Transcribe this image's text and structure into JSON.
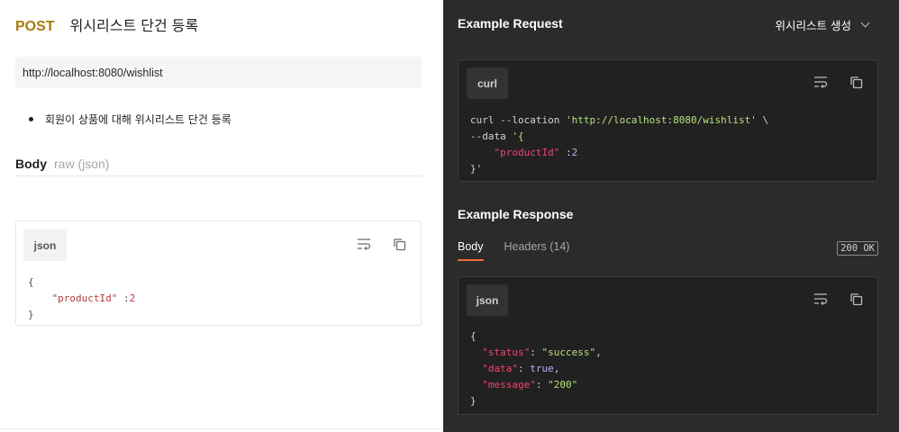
{
  "request": {
    "method": "POST",
    "title": "위시리스트 단건 등록",
    "url": "http://localhost:8080/wishlist",
    "description": "회원이 상품에 대해 위시리스트 단건 등록",
    "body_label": "Body",
    "body_type": "raw (json)",
    "body_lang": "json",
    "body_code": {
      "open": "{",
      "key": "\"productId\"",
      "sep": " :",
      "value": "2",
      "close": "}"
    }
  },
  "example_request": {
    "title": "Example Request",
    "selected_example": "위시리스트 생성",
    "lang": "curl",
    "code": {
      "line1_cmd": "curl --location ",
      "line1_url": "'http://localhost:8080/wishlist'",
      "line1_tail": " \\",
      "line2_cmd": "--data ",
      "line2_str": "'{",
      "line3_key": "\"productId\"",
      "line3_sep": " :",
      "line3_val": "2",
      "line4_close": "}",
      "line4_quote": "'"
    }
  },
  "example_response": {
    "title": "Example Response",
    "tabs": [
      {
        "label": "Body",
        "active": true
      },
      {
        "label": "Headers (14)",
        "active": false
      }
    ],
    "status": "200 OK",
    "lang": "json",
    "code": {
      "open": "{",
      "k1": "\"status\"",
      "v1": "\"success\"",
      "k2": "\"data\"",
      "v2": "true",
      "k3": "\"message\"",
      "v3": "\"200\"",
      "close": "}"
    }
  },
  "icons": [
    "wrap-lines-icon",
    "copy-icon",
    "chevron-down-icon"
  ],
  "colors": {
    "method": "#a87b0f",
    "dark_bg": "#2b2b2b",
    "code_bg": "#212121",
    "tab_accent": "#f26b3a",
    "json_key": "#f0456e",
    "json_string": "#b9e07b",
    "json_literal": "#c9a7ff"
  }
}
